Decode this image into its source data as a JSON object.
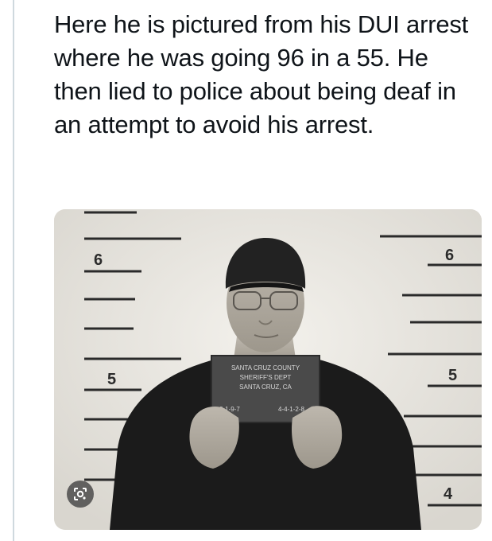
{
  "post": {
    "text": "Here he is pictured from his DUI arrest where he was going 96 in a 55. He then lied to police about being deaf in an attempt to avoid his arrest."
  },
  "photo": {
    "height_marks": {
      "left": [
        "6",
        "5"
      ],
      "right": [
        "6",
        "5",
        "4"
      ]
    },
    "placard": {
      "line1": "SANTA CRUZ COUNTY",
      "line2": "SHERIFF'S DEPT",
      "line3": "SANTA CRUZ, CA",
      "bottom_left": "2-1-9-7",
      "bottom_right": "4-4-1-2-8"
    }
  },
  "icons": {
    "lens": "google-lens-icon"
  },
  "colors": {
    "text": "#0f1419",
    "thread_line": "#cfd9de"
  }
}
